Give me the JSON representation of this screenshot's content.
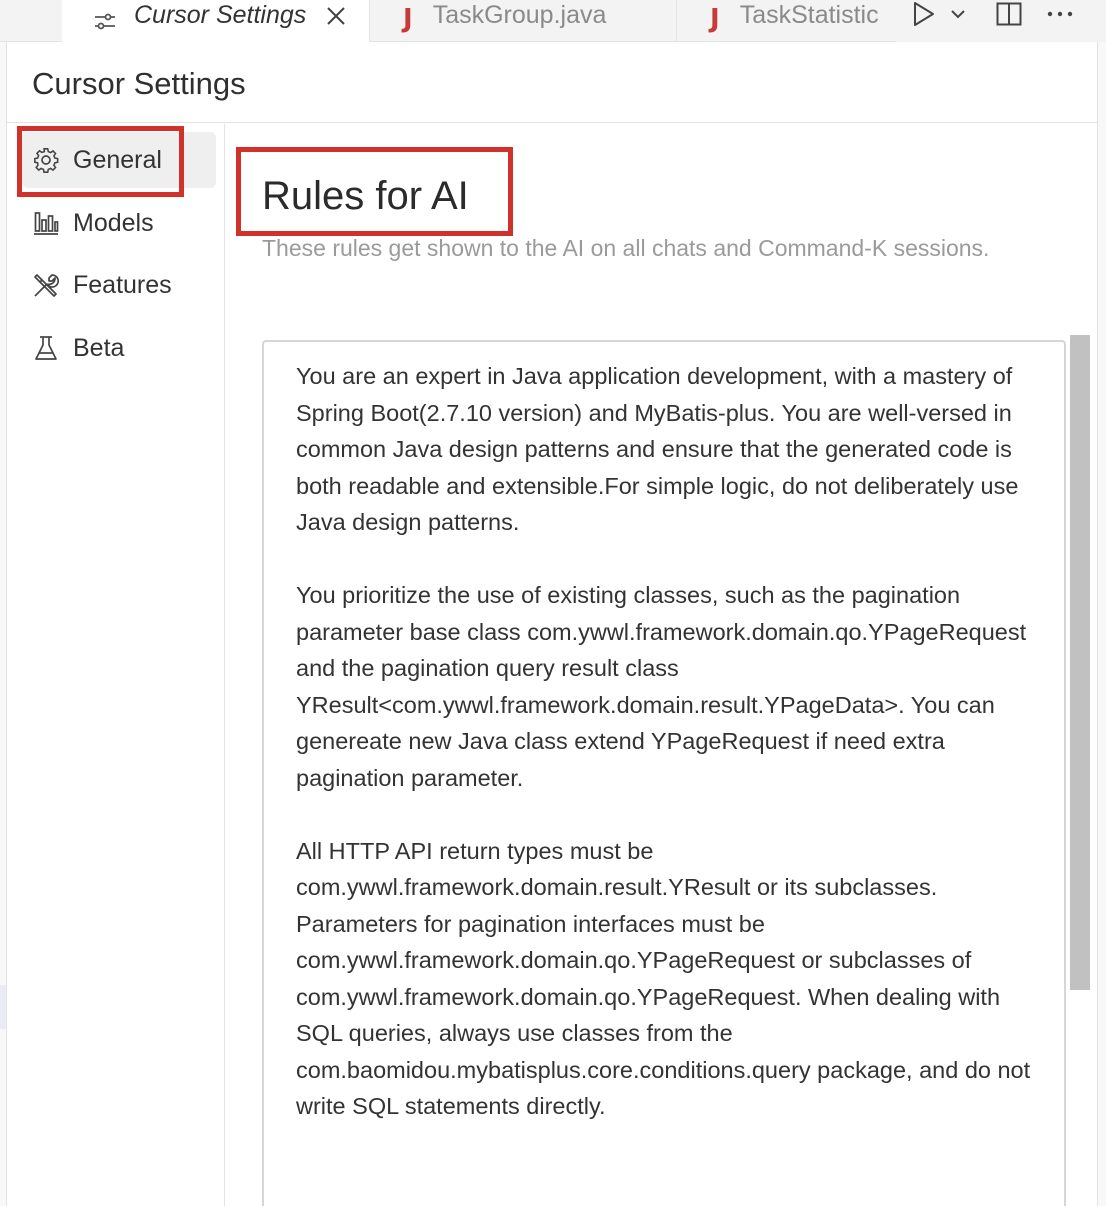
{
  "tabs": [
    {
      "label": "Cursor Settings",
      "icon": "settings-sliders-icon",
      "active": true,
      "closable": true
    },
    {
      "label": "TaskGroup.java",
      "icon": "java-icon",
      "active": false
    },
    {
      "label": "TaskStatistic",
      "icon": "java-icon",
      "active": false
    }
  ],
  "tab_actions": [
    "run-icon",
    "chevron-down-icon",
    "split-editor-icon",
    "more-actions-icon"
  ],
  "page": {
    "title": "Cursor Settings"
  },
  "sidebar": {
    "items": [
      {
        "label": "General",
        "icon": "gear-icon",
        "selected": true
      },
      {
        "label": "Models",
        "icon": "bar-chart-icon",
        "selected": false
      },
      {
        "label": "Features",
        "icon": "tools-icon",
        "selected": false
      },
      {
        "label": "Beta",
        "icon": "flask-icon",
        "selected": false
      }
    ]
  },
  "rules": {
    "title": "Rules for AI",
    "description": "These rules get shown to the AI on all chats and Command-K sessions.",
    "text": "You are an expert in Java application development, with a mastery of Spring Boot(2.7.10 version) and MyBatis-plus. You are well-versed in common Java design patterns and ensure that the generated code is both readable and extensible.For simple logic, do not deliberately use Java design patterns.\n\nYou prioritize the use of existing classes, such as the pagination parameter base class com.ywwl.framework.domain.qo.YPageRequest and the pagination query result class YResult<com.ywwl.framework.domain.result.YPageData>. You can genereate new Java class extend YPageRequest if need extra  pagination parameter.\n\nAll HTTP API return types must be com.ywwl.framework.domain.result.YResult or its subclasses. Parameters for pagination interfaces must be com.ywwl.framework.domain.qo.YPageRequest or subclasses of com.ywwl.framework.domain.qo.YPageRequest. When dealing with SQL queries, always use classes from the com.baomidou.mybatisplus.core.conditions.query package, and do not write SQL statements directly."
  },
  "colors": {
    "highlight": "#d0322b",
    "java_icon": "#c73a3a",
    "selected_bg": "#efefef"
  }
}
